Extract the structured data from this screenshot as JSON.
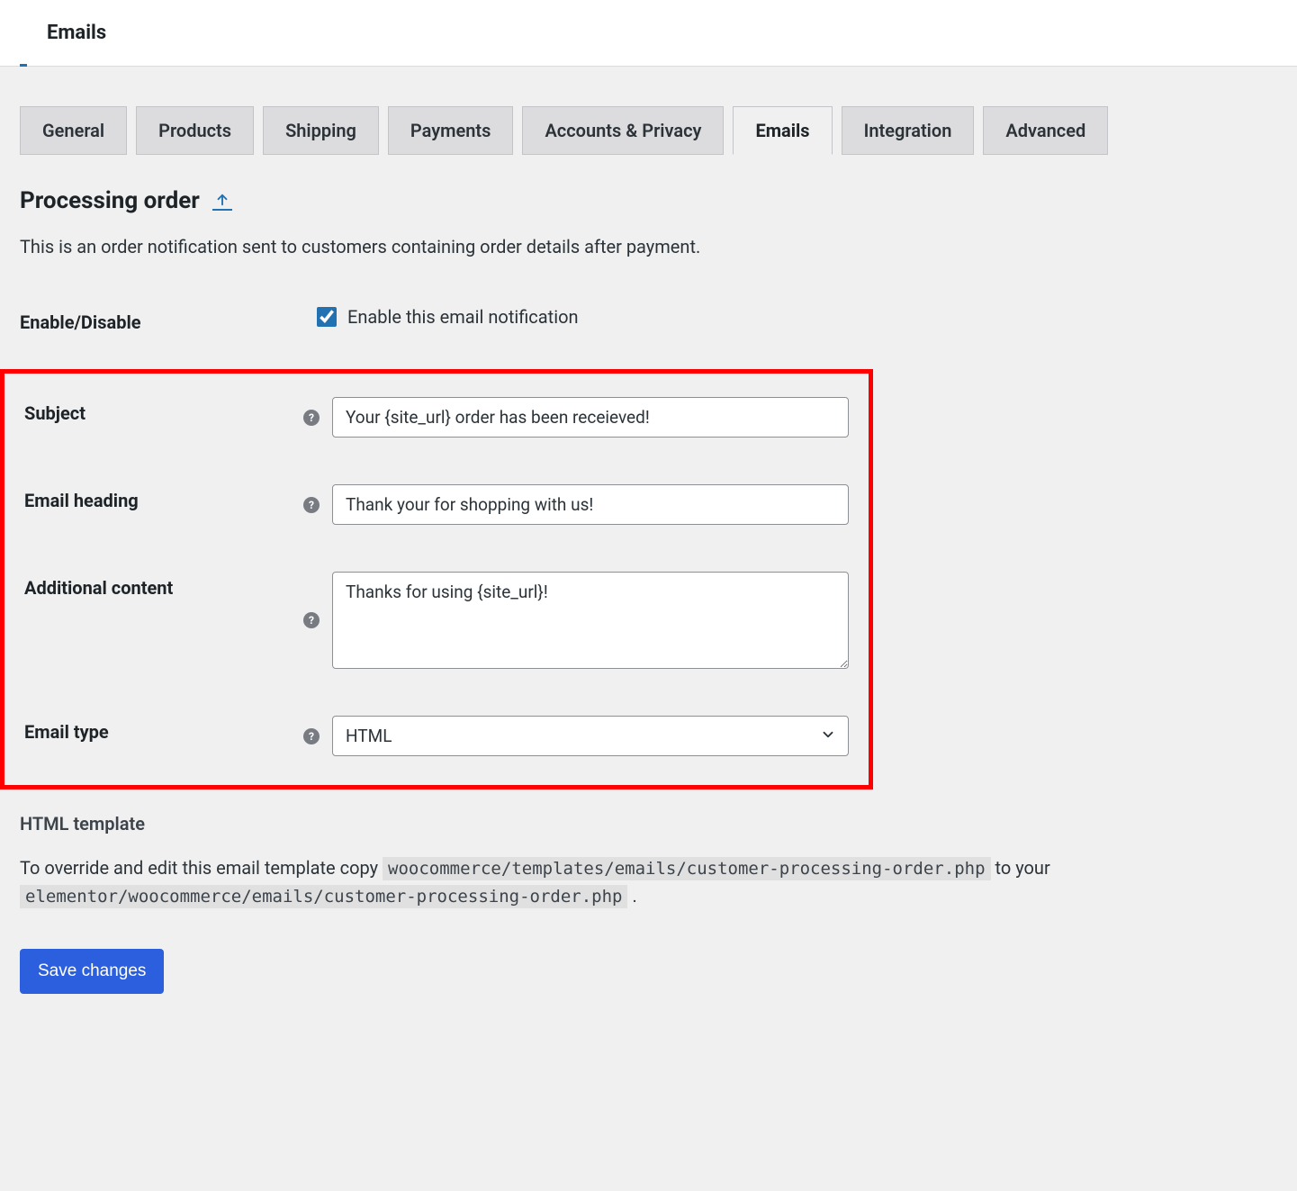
{
  "header": {
    "title": "Emails"
  },
  "tabs": [
    {
      "label": "General",
      "active": false
    },
    {
      "label": "Products",
      "active": false
    },
    {
      "label": "Shipping",
      "active": false
    },
    {
      "label": "Payments",
      "active": false
    },
    {
      "label": "Accounts & Privacy",
      "active": false
    },
    {
      "label": "Emails",
      "active": true
    },
    {
      "label": "Integration",
      "active": false
    },
    {
      "label": "Advanced",
      "active": false
    }
  ],
  "page": {
    "title": "Processing order",
    "description": "This is an order notification sent to customers containing order details after payment."
  },
  "fields": {
    "enable": {
      "label": "Enable/Disable",
      "checkbox_label": "Enable this email notification",
      "checked": true
    },
    "subject": {
      "label": "Subject",
      "value": "Your {site_url} order has been receieved!"
    },
    "email_heading": {
      "label": "Email heading",
      "value": "Thank your for shopping with us!"
    },
    "additional_content": {
      "label": "Additional content",
      "value": "Thanks for using {site_url}!"
    },
    "email_type": {
      "label": "Email type",
      "value": "HTML"
    }
  },
  "template": {
    "heading": "HTML template",
    "text_prefix": "To override and edit this email template copy ",
    "code1": "woocommerce/templates/emails/customer-processing-order.php",
    "text_mid": " to your ",
    "code2": "elementor/woocommerce/emails/customer-processing-order.php",
    "text_suffix": " ."
  },
  "buttons": {
    "save": "Save changes"
  }
}
